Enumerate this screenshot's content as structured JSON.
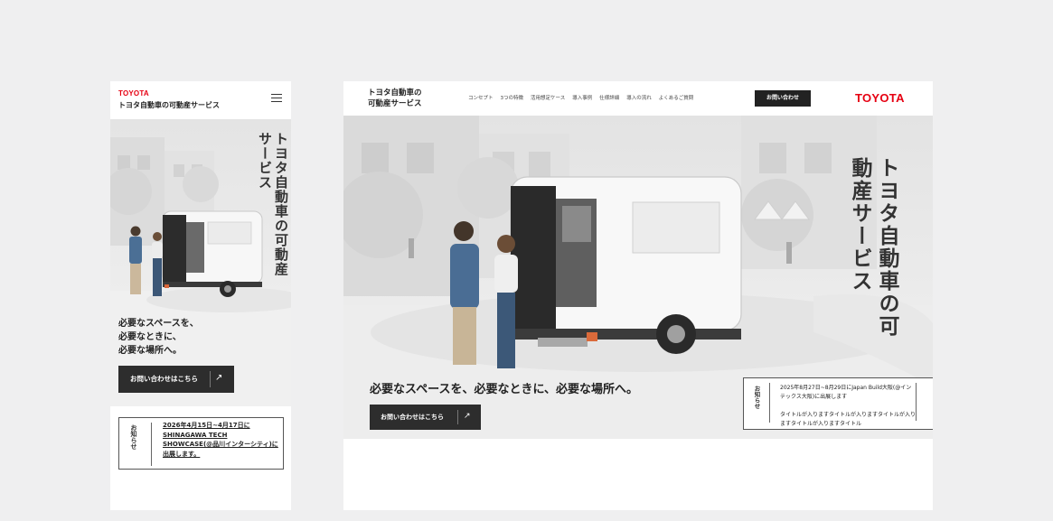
{
  "mobile": {
    "brand": "TOYOTA",
    "service_name": "トヨタ自動車の可動産サービス",
    "hero_title": "トヨタ自動車の可動産サービス",
    "copy_lines": [
      "必要なスペースを、",
      "必要なときに、",
      "必要な場所へ。"
    ],
    "cta_label": "お問い合わせはこちら",
    "cta_arrow": "↗",
    "news_label": "お知らせ",
    "news_text": "2026年4月15日~4月17日にSHINAGAWA TECH SHOWCASE(@品川インターシティ)に出展します。"
  },
  "desktop": {
    "service_name_line1": "トヨタ自動車の",
    "service_name_line2": "可動産サービス",
    "nav": [
      "コンセプト",
      "3つの特徴",
      "活用想定ケース",
      "導入事例",
      "仕様詳細",
      "導入の流れ",
      "よくあるご質問"
    ],
    "contact_label": "お問い合わせ",
    "brand": "TOYOTA",
    "hero_title": "トヨタ自動車の可動産サービス",
    "tagline": "必要なスペースを、必要なときに、必要な場所へ。",
    "cta_label": "お問い合わせはこちら",
    "cta_arrow": "↗",
    "news_label": "お知らせ",
    "news_item_1": "2025年8月27日~8月29日にJapan Build大阪(@インテックス大阪)に出展します",
    "news_item_2": "タイトルが入りますタイトルが入りますタイトルが入りますタイトルが入りますタイトル"
  },
  "colors": {
    "background": "#efeff0",
    "toyota_red": "#e60012",
    "button_dark": "#2d2d2d"
  }
}
